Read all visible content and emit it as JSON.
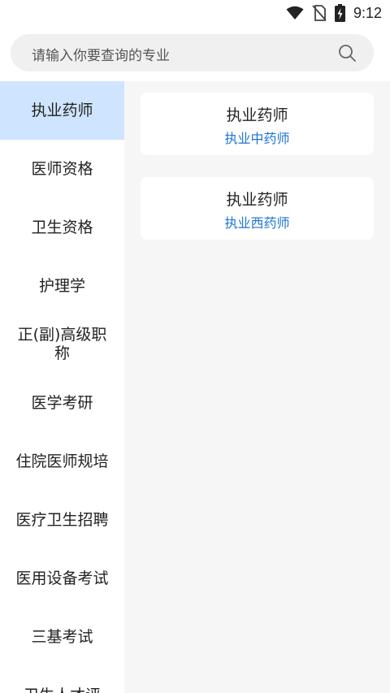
{
  "status_bar": {
    "time": "9:12",
    "icons": [
      "wifi-icon",
      "no-sim-icon",
      "battery-charging-icon"
    ]
  },
  "search": {
    "placeholder": "请输入你要查询的专业",
    "icon": "search-icon"
  },
  "sidebar": {
    "items": [
      {
        "label": "执业药师",
        "active": true
      },
      {
        "label": "医师资格",
        "active": false
      },
      {
        "label": "卫生资格",
        "active": false
      },
      {
        "label": "护理学",
        "active": false
      },
      {
        "label": "正(副)高级职称",
        "active": false
      },
      {
        "label": "医学考研",
        "active": false
      },
      {
        "label": "住院医师规培",
        "active": false
      },
      {
        "label": "医疗卫生招聘",
        "active": false
      },
      {
        "label": "医用设备考试",
        "active": false
      },
      {
        "label": "三基考试",
        "active": false
      },
      {
        "label": "卫生人才评",
        "active": false
      }
    ]
  },
  "content": {
    "cards": [
      {
        "title": "执业药师",
        "subtitle": "执业中药师"
      },
      {
        "title": "执业药师",
        "subtitle": "执业西药师"
      }
    ]
  },
  "colors": {
    "active_bg": "#cfe5ff",
    "link_blue": "#1e74d6",
    "panel_bg": "#f6f6f6"
  }
}
